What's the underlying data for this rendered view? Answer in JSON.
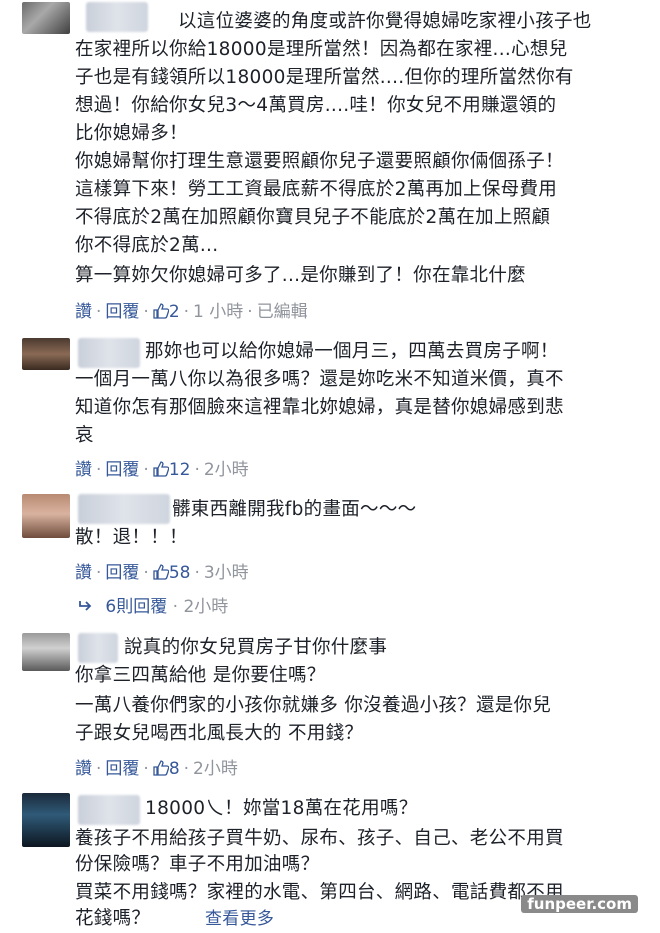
{
  "comments": [
    {
      "lines": [
        "以這位婆婆的角度或許你覺得媳婦吃家裡小孩子也",
        "在家裡所以你給18000是理所當然！因為都在家裡...心想兒",
        "子也是有錢領所以18000是理所當然....但你的理所當然你有",
        "想過！你給你女兒3～4萬買房....哇！你女兒不用賺還領的",
        "比你媳婦多！",
        "你媳婦幫你打理生意還要照顧你兒子還要照顧你倆個孫子！",
        "這樣算下來！勞工工資最底薪不得底於2萬再加上保母費用",
        "不得底於2萬在加照顧你寶貝兒子不能底於2萬在加上照顧",
        "你不得底於2萬...",
        "算一算妳欠你媳婦可多了...是你賺到了！你在靠北什麼"
      ],
      "likes": "2",
      "time": "1 小時",
      "edited": "已編輯"
    },
    {
      "lines": [
        "那妳也可以給你媳婦一個月三，四萬去買房子啊！",
        "一個月一萬八你以為很多嗎？還是妳吃米不知道米價，真不",
        "知道你怎有那個臉來這裡靠北妳媳婦，真是替你媳婦感到悲",
        "哀"
      ],
      "likes": "12",
      "time": "2小時"
    },
    {
      "lines": [
        "髒東西離開我fb的畫面～～～",
        "散！退！！！"
      ],
      "likes": "58",
      "time": "3小時",
      "replies": "6則回覆",
      "replies_time": "2小時"
    },
    {
      "lines": [
        "說真的你女兒買房子甘你什麼事",
        "你拿三四萬給他 是你要住嗎？",
        "一萬八養你們家的小孩你就嫌多 你沒養過小孩？還是你兒",
        "子跟女兒喝西北風長大的 不用錢？"
      ],
      "likes": "8",
      "time": "2小時"
    },
    {
      "lines": [
        "18000乀！妳當18萬在花用嗎？",
        "養孩子不用給孩子買牛奶、尿布、孩子、自己、老公不用買",
        "份保險嗎？車子不用加油嗎？",
        "買菜不用錢嗎？家裡的水電、第四台、網路、電話費都不用",
        "花錢嗎？",
        "查看更多"
      ]
    }
  ],
  "actions": {
    "like": "讚",
    "reply": "回覆"
  },
  "watermark": "funpeer.com"
}
